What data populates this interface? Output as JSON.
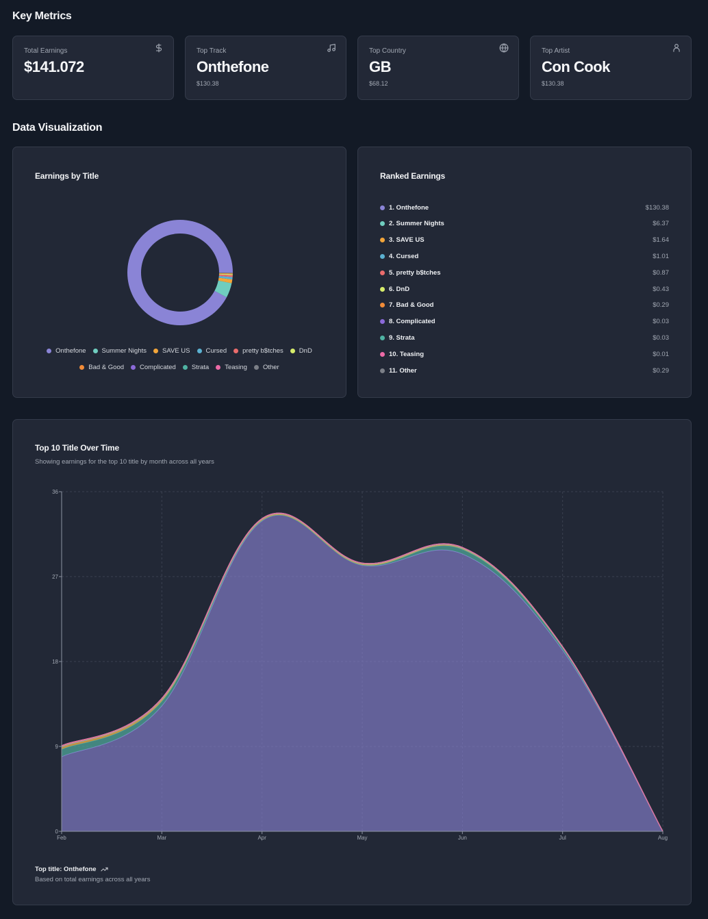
{
  "sections": {
    "key_metrics": "Key Metrics",
    "data_viz": "Data Visualization"
  },
  "metrics": [
    {
      "label": "Total Earnings",
      "value": "$141.072",
      "sub": "",
      "icon": "dollar-icon"
    },
    {
      "label": "Top Track",
      "value": "Onthefone",
      "sub": "$130.38",
      "icon": "music-note-icon"
    },
    {
      "label": "Top Country",
      "value": "GB",
      "sub": "$68.12",
      "icon": "globe-icon"
    },
    {
      "label": "Top Artist",
      "value": "Con Cook",
      "sub": "$130.38",
      "icon": "user-icon"
    }
  ],
  "donut_panel": {
    "title": "Earnings by Title"
  },
  "ranked_panel": {
    "title": "Ranked Earnings",
    "items": [
      {
        "label": "1. Onthefone",
        "amount": "$130.38",
        "color": "#8a84d6"
      },
      {
        "label": "2. Summer Nights",
        "amount": "$6.37",
        "color": "#6fcdbf"
      },
      {
        "label": "3. SAVE US",
        "amount": "$1.64",
        "color": "#f2a53a"
      },
      {
        "label": "4. Cursed",
        "amount": "$1.01",
        "color": "#5bb1d1"
      },
      {
        "label": "5. pretty b$tches",
        "amount": "$0.87",
        "color": "#ea6c6c"
      },
      {
        "label": "6. DnD",
        "amount": "$0.43",
        "color": "#d6ec6b"
      },
      {
        "label": "7. Bad & Good",
        "amount": "$0.29",
        "color": "#f28c38"
      },
      {
        "label": "8. Complicated",
        "amount": "$0.03",
        "color": "#8b6ad9"
      },
      {
        "label": "9. Strata",
        "amount": "$0.03",
        "color": "#4fb3a3"
      },
      {
        "label": "10. Teasing",
        "amount": "$0.01",
        "color": "#ec6aa6"
      },
      {
        "label": "11. Other",
        "amount": "$0.29",
        "color": "#7b7f87"
      }
    ]
  },
  "area_panel": {
    "title": "Top 10 Title Over Time",
    "subtitle": "Showing earnings for the top 10 title by month across all years",
    "footer_title": "Top title: Onthefone",
    "footer_icon": "trending-up-icon",
    "footer_sub": "Based on total earnings across all years"
  },
  "chart_data": [
    {
      "type": "pie",
      "title": "Earnings by Title",
      "variant": "donut",
      "labels": [
        "Onthefone",
        "Summer Nights",
        "SAVE US",
        "Cursed",
        "pretty b$tches",
        "DnD",
        "Bad & Good",
        "Complicated",
        "Strata",
        "Teasing",
        "Other"
      ],
      "values": [
        130.38,
        6.37,
        1.64,
        1.01,
        0.87,
        0.43,
        0.29,
        0.03,
        0.03,
        0.01,
        0.29
      ],
      "colors": [
        "#8a84d6",
        "#6fcdbf",
        "#f2a53a",
        "#5bb1d1",
        "#ea6c6c",
        "#d6ec6b",
        "#f28c38",
        "#8b6ad9",
        "#4fb3a3",
        "#ec6aa6",
        "#7b7f87"
      ],
      "legend": "bottom"
    },
    {
      "type": "area",
      "stacked": true,
      "title": "Top 10 Title Over Time",
      "x": [
        "Feb",
        "Mar",
        "Apr",
        "May",
        "Jun",
        "Jul",
        "Aug"
      ],
      "xlabel": "",
      "ylabel": "",
      "ylim": [
        0,
        36
      ],
      "yticks": [
        0,
        9,
        18,
        27,
        36
      ],
      "grid": true,
      "series": [
        {
          "name": "Onthefone",
          "color": "#8a84d6",
          "values": [
            7.9,
            13.3,
            32.9,
            28.2,
            29.4,
            19.2,
            0
          ]
        },
        {
          "name": "Summer Nights",
          "color": "#4fa59a",
          "values": [
            0.8,
            0.5,
            0.05,
            0.05,
            0.5,
            0.25,
            0
          ]
        },
        {
          "name": "SAVE US",
          "color": "#f2a53a",
          "values": [
            0.2,
            0.15,
            0.1,
            0.08,
            0.08,
            0.05,
            0
          ]
        },
        {
          "name": "Cursed",
          "color": "#5bb1d1",
          "values": [
            0.05,
            0.05,
            0.03,
            0.03,
            0.03,
            0.02,
            0
          ]
        },
        {
          "name": "pretty b$tches",
          "color": "#ea6c6c",
          "values": [
            0.05,
            0.05,
            0.03,
            0.03,
            0.03,
            0.02,
            0
          ]
        },
        {
          "name": "DnD",
          "color": "#d6ec6b",
          "values": [
            0.05,
            0.03,
            0.02,
            0.02,
            0.02,
            0.02,
            0
          ]
        },
        {
          "name": "Bad & Good",
          "color": "#f28c38",
          "values": [
            0.02,
            0.02,
            0.02,
            0.02,
            0.02,
            0.02,
            0
          ]
        },
        {
          "name": "Complicated",
          "color": "#8b6ad9",
          "values": [
            0,
            0,
            0,
            0,
            0.01,
            0,
            0
          ]
        },
        {
          "name": "Strata",
          "color": "#4fb3a3",
          "values": [
            0,
            0,
            0,
            0.01,
            0,
            0,
            0
          ]
        },
        {
          "name": "Teasing",
          "color": "#ec6aa6",
          "values": [
            0,
            0,
            0,
            0,
            0.01,
            0,
            0
          ]
        }
      ]
    }
  ]
}
